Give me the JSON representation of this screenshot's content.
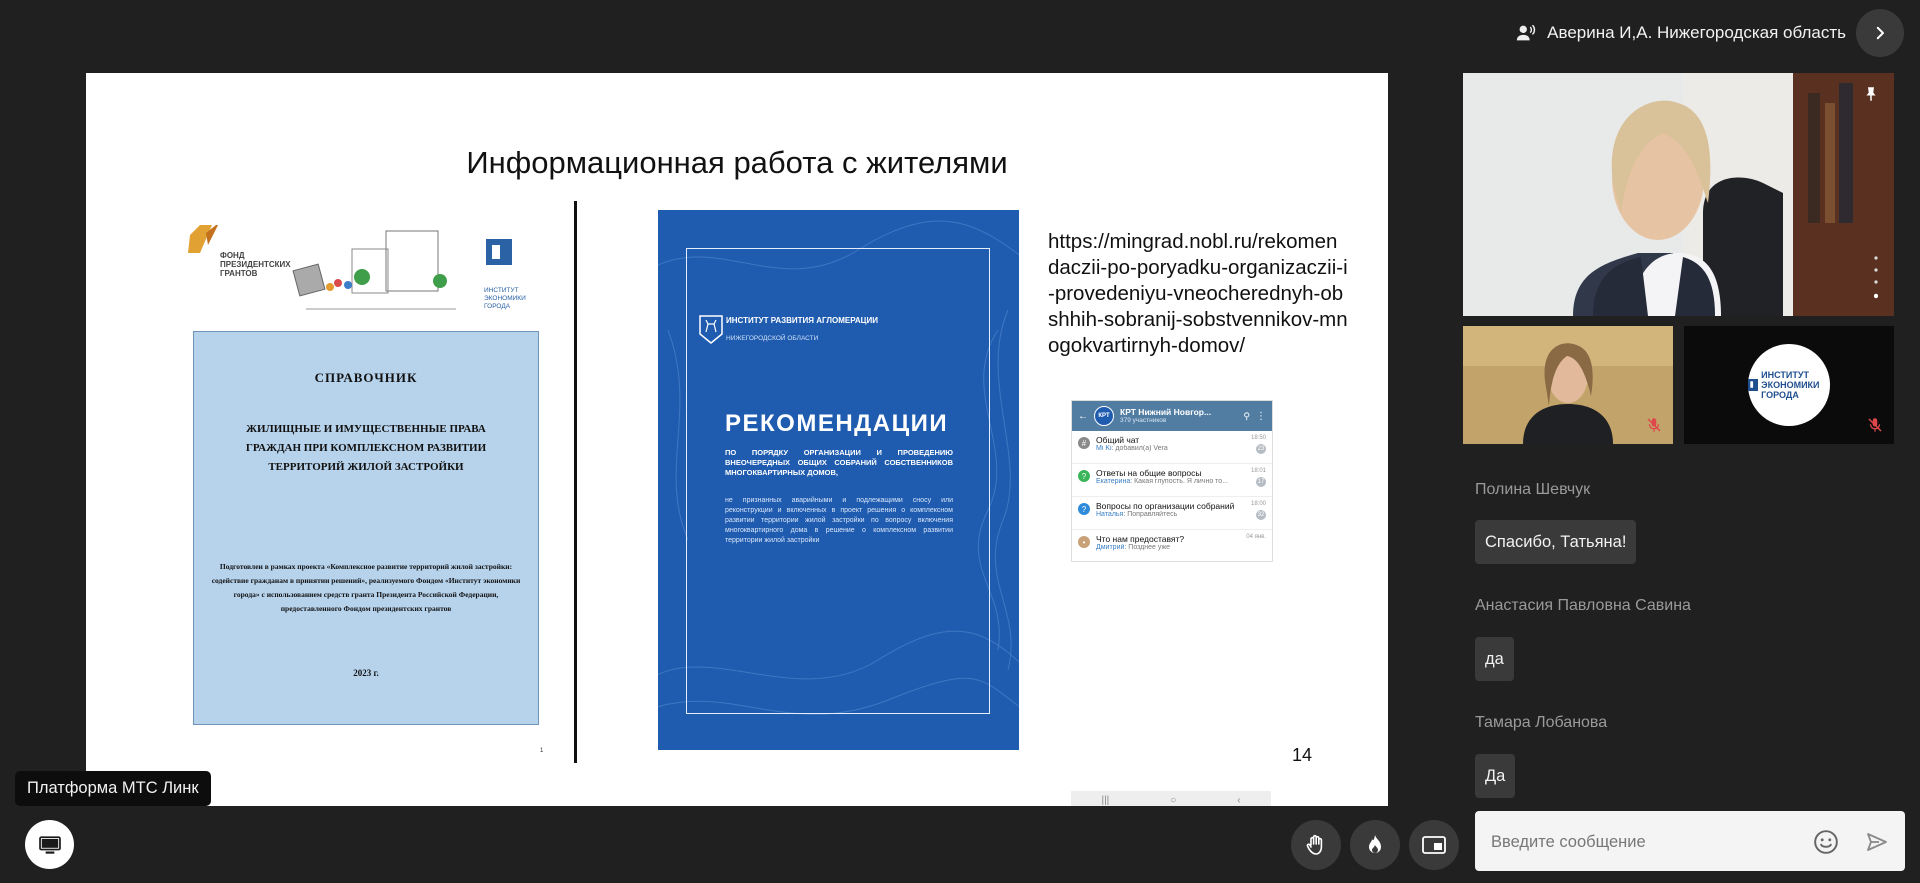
{
  "header": {
    "speaker_name": "Аверина И,А. Нижегородская область"
  },
  "slide": {
    "title": "Информационная работа с жителями",
    "logos": {
      "fund": "Фонд президентских грантов",
      "institute": "Институт экономики города"
    },
    "handbook": {
      "title": "СПРАВОЧНИК",
      "subtitle": "Жилищные и имущественные права граждан при комплексном развитии территорий жилой застройки",
      "note": "Подготовлен в рамках проекта «Комплексное развитие территорий жилой застройки: содействие гражданам в принятии решений», реализуемого Фондом «Институт экономики города» с использованием средств гранта Президента Российской Федерации, предоставленного Фондом президентских грантов",
      "year": "2023 г.",
      "page_mark": "1"
    },
    "recommendations": {
      "institute": "Институт развития агломерации",
      "institute_sub": "Нижегородской области",
      "title": "РЕКОМЕНДАЦИИ",
      "subtitle": "по порядку организации и проведению внеочередных общих собраний собственников многоквартирных домов,",
      "description": "не признанных аварийными и подлежащими сносу или реконструкции и включенных в проект решения о комплексном развитии территории жилой застройки по вопросу включения многоквартирного дома в решение о комплексном развитии территории жилой застройки"
    },
    "url": "https://mingrad.nobl.ru/rekomendaczii-po-poryadku-organizaczii-i-provedeniyu-vneocherednyh-obshhih-sobranij-sobstvennikov-mnogokvartirnyh-domov/",
    "page_number": "14",
    "telegram": {
      "avatar_text": "КРТ",
      "group_name": "КРТ Нижний Новгор...",
      "members": "379 участников",
      "chats": [
        {
          "title": "Общий чат",
          "author": "Mi Ki",
          "last": "добавил(а) Vera",
          "time": "18:50",
          "badge": "23",
          "icon_color": "#8a8a8a",
          "icon": "#"
        },
        {
          "title": "Ответы на общие вопросы",
          "author": "Екатерина",
          "last": "Какая глупость. Я лично то...",
          "time": "18:01",
          "badge": "17",
          "icon_color": "#3cb55a",
          "icon": "?"
        },
        {
          "title": "Вопросы по организации собраний",
          "author": "Наталья",
          "last": "Поправляйтесь",
          "time": "18:00",
          "badge": "32",
          "icon_color": "#2e8bdc",
          "icon": "?"
        },
        {
          "title": "Что нам предоставят?",
          "author": "Дмитрий",
          "last": "Позднее уже",
          "time": "04 янв.",
          "badge": "",
          "icon_color": "#c9a178",
          "icon": "•"
        }
      ]
    }
  },
  "participants": {
    "org_name": "ИНСТИТУТ ЭКОНОМИКИ ГОРОДА"
  },
  "chat": {
    "messages": [
      {
        "author": "Полина Шевчук",
        "text": "Спасибо, Татьяна!"
      },
      {
        "author": "Анастасия Павловна Савина",
        "text": "да"
      },
      {
        "author": "Тамара Лобанова",
        "text": "Да"
      }
    ],
    "input_placeholder": "Введите сообщение"
  },
  "footer": {
    "platform_label": "Платформа МТС Линк"
  },
  "colors": {
    "background": "#202020",
    "recommendations_blue": "#1f5cb0",
    "handbook_blue": "#b7d3ec",
    "bubble": "#3a3a3a",
    "mic_off": "#e0474c"
  },
  "icons": [
    "speaker-icon",
    "chevron-right-icon",
    "pin-icon",
    "mic-off-icon",
    "emoji-icon",
    "send-icon",
    "screen-share-icon",
    "raise-hand-icon",
    "fire-reaction-icon",
    "layout-icon"
  ]
}
